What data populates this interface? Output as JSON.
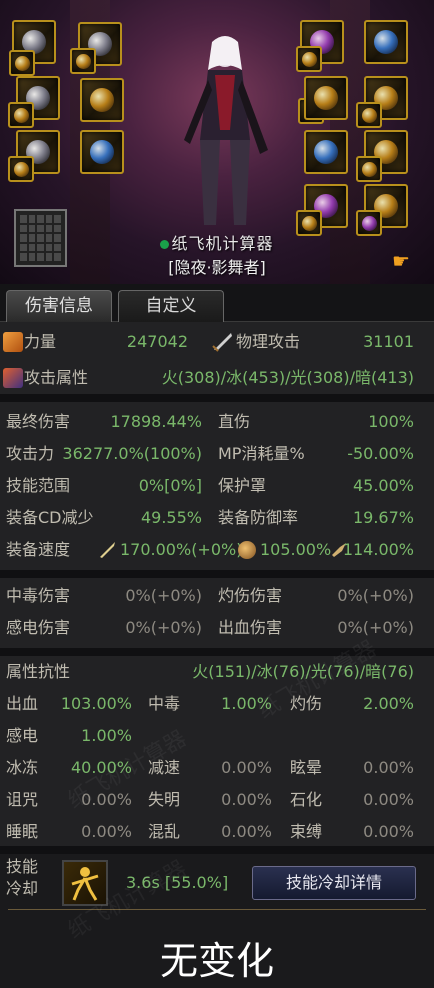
{
  "character": {
    "name": "纸飞机计算器",
    "class": "[隐夜·影舞者]"
  },
  "tabs": [
    {
      "label": "伤害信息",
      "active": true
    },
    {
      "label": "自定义",
      "active": false
    }
  ],
  "primary": {
    "strength_label": "力量",
    "strength_value": "247042",
    "physical_attack_label": "物理攻击",
    "physical_attack_value": "31101",
    "attack_element_label": "攻击属性",
    "attack_element_value": "火(308)/冰(453)/光(308)/暗(413)"
  },
  "damage": {
    "final_damage_label": "最终伤害",
    "final_damage_value": "17898.44%",
    "direct_damage_label": "直伤",
    "direct_damage_value": "100%",
    "attack_power_label": "攻击力",
    "attack_power_value": "36277.0%(100%)",
    "mp_cost_label": "MP消耗量%",
    "mp_cost_value": "-50.00%",
    "skill_range_label": "技能范围",
    "skill_range_value": "0%[0%]",
    "shield_label": "保护罩",
    "shield_value": "45.00%",
    "equip_cd_label": "装备CD减少",
    "equip_cd_value": "49.55%",
    "equip_defense_label": "装备防御率",
    "equip_defense_value": "19.67%",
    "equip_speed_label": "装备速度",
    "speed_1": "170.00%(+0%)",
    "speed_2": "105.00%",
    "speed_3": "114.00%"
  },
  "status_damage": {
    "poison_label": "中毒伤害",
    "poison_value": "0%(+0%)",
    "burn_label": "灼伤伤害",
    "burn_value": "0%(+0%)",
    "shock_label": "感电伤害",
    "shock_value": "0%(+0%)",
    "bleed_label": "出血伤害",
    "bleed_value": "0%(+0%)"
  },
  "resistance": {
    "element_res_label": "属性抗性",
    "element_res_value": "火(151)/冰(76)/光(76)/暗(76)",
    "rows": [
      [
        {
          "label": "出血",
          "value": "103.00%"
        },
        {
          "label": "中毒",
          "value": "1.00%"
        },
        {
          "label": "灼伤",
          "value": "2.00%"
        }
      ],
      [
        {
          "label": "感电",
          "value": "1.00%"
        }
      ],
      [
        {
          "label": "冰冻",
          "value": "40.00%"
        },
        {
          "label": "减速",
          "value": "0.00%"
        },
        {
          "label": "眩晕",
          "value": "0.00%"
        }
      ],
      [
        {
          "label": "诅咒",
          "value": "0.00%"
        },
        {
          "label": "失明",
          "value": "0.00%"
        },
        {
          "label": "石化",
          "value": "0.00%"
        }
      ],
      [
        {
          "label": "睡眠",
          "value": "0.00%"
        },
        {
          "label": "混乱",
          "value": "0.00%"
        },
        {
          "label": "束缚",
          "value": "0.00%"
        }
      ]
    ]
  },
  "cooldown": {
    "label_line1": "技能",
    "label_line2": "冷却",
    "value": "3.6s [55.0%]",
    "button_label": "技能冷却详情"
  },
  "footer": {
    "status": "无变化"
  },
  "watermark": "纸飞机计算器"
}
